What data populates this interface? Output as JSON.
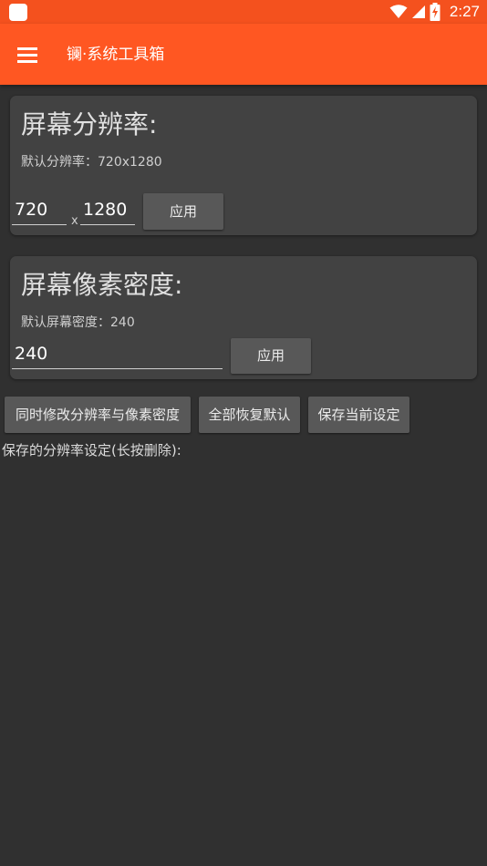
{
  "status_bar": {
    "time": "2:27",
    "icons": [
      "wifi-icon",
      "signal-icon",
      "battery-icon"
    ]
  },
  "app_bar": {
    "title": "镧·系统工具箱",
    "menu_icon": "menu-icon"
  },
  "resolution_card": {
    "title": "屏幕分辨率:",
    "default_text": "默认分辨率：720x1280",
    "width_value": "720",
    "separator": "x",
    "height_value": "1280",
    "apply_label": "应用"
  },
  "density_card": {
    "title": "屏幕像素密度:",
    "default_text": "默认屏幕密度：240",
    "density_value": "240",
    "apply_label": "应用"
  },
  "actions": {
    "modify_both_label": "同时修改分辨率与像素密度",
    "restore_all_label": "全部恢复默认",
    "save_current_label": "保存当前设定"
  },
  "saved_settings": {
    "label": "保存的分辨率设定(长按删除):"
  },
  "colors": {
    "accent": "#ff5722",
    "status_bar": "#f4511e",
    "background": "#303030",
    "card": "#424242",
    "button": "#585858"
  }
}
